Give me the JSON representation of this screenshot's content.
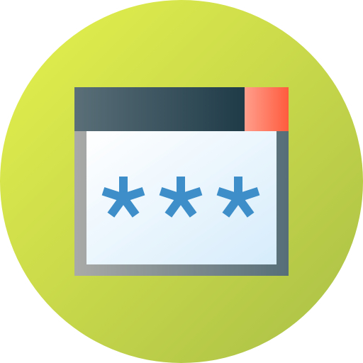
{
  "icon": {
    "name": "password-window-icon",
    "masked_characters": 3
  },
  "colors": {
    "circle_light": "#e6f24d",
    "circle_dark": "#a9be47",
    "frame_light": "#a9aaa8",
    "frame_dark": "#566e78",
    "titlebar_light": "#5a6f78",
    "titlebar_dark": "#1f3b48",
    "close_light": "#ff9e8c",
    "close_dark": "#ff5b3d",
    "panel_light": "#ffffff",
    "panel_dark": "#d6ecfb",
    "asterisk": "#3d8ec9"
  }
}
